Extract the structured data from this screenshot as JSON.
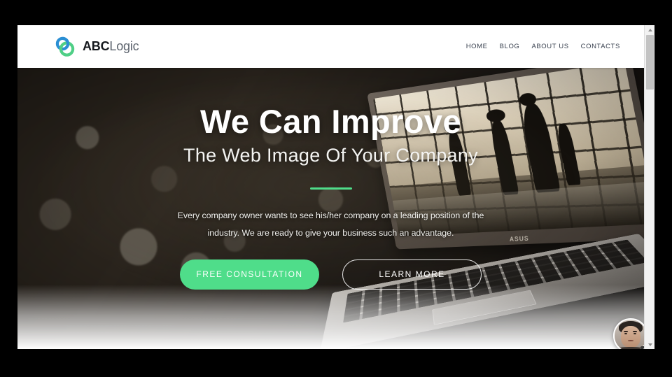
{
  "header": {
    "brand_bold": "ABC",
    "brand_light": "Logic",
    "logo_icon": "two-interlocking-rings-logo",
    "nav": [
      {
        "label": "HOME"
      },
      {
        "label": "BLOG"
      },
      {
        "label": "ABOUT US"
      },
      {
        "label": "CONTACTS"
      }
    ]
  },
  "hero": {
    "title": "We Can Improve",
    "subtitle": "The Web Image Of Your Company",
    "paragraph": "Every company owner wants to see his/her company on a leading position of the industry. We are ready to give your business such an advantage.",
    "primary_button": "FREE CONSULTATION",
    "secondary_button": "LEARN MORE",
    "background_image": "open-asus-laptop-on-dark-bokeh-background",
    "screen_image": "silhouettes-of-people-in-front-of-bright-windows"
  },
  "chat_widget": {
    "avatar_icon": "person-avatar",
    "caret_icon": "chevron-down-icon"
  },
  "scrollbar": {
    "up_icon": "triangle-up-icon",
    "down_icon": "triangle-down-icon"
  },
  "colors": {
    "accent_green": "#4fdd8a",
    "logo_blue": "#2b8fd4",
    "logo_green": "#4fcf86",
    "nav_text": "#39414f",
    "hero_dark": "#1b1712"
  }
}
